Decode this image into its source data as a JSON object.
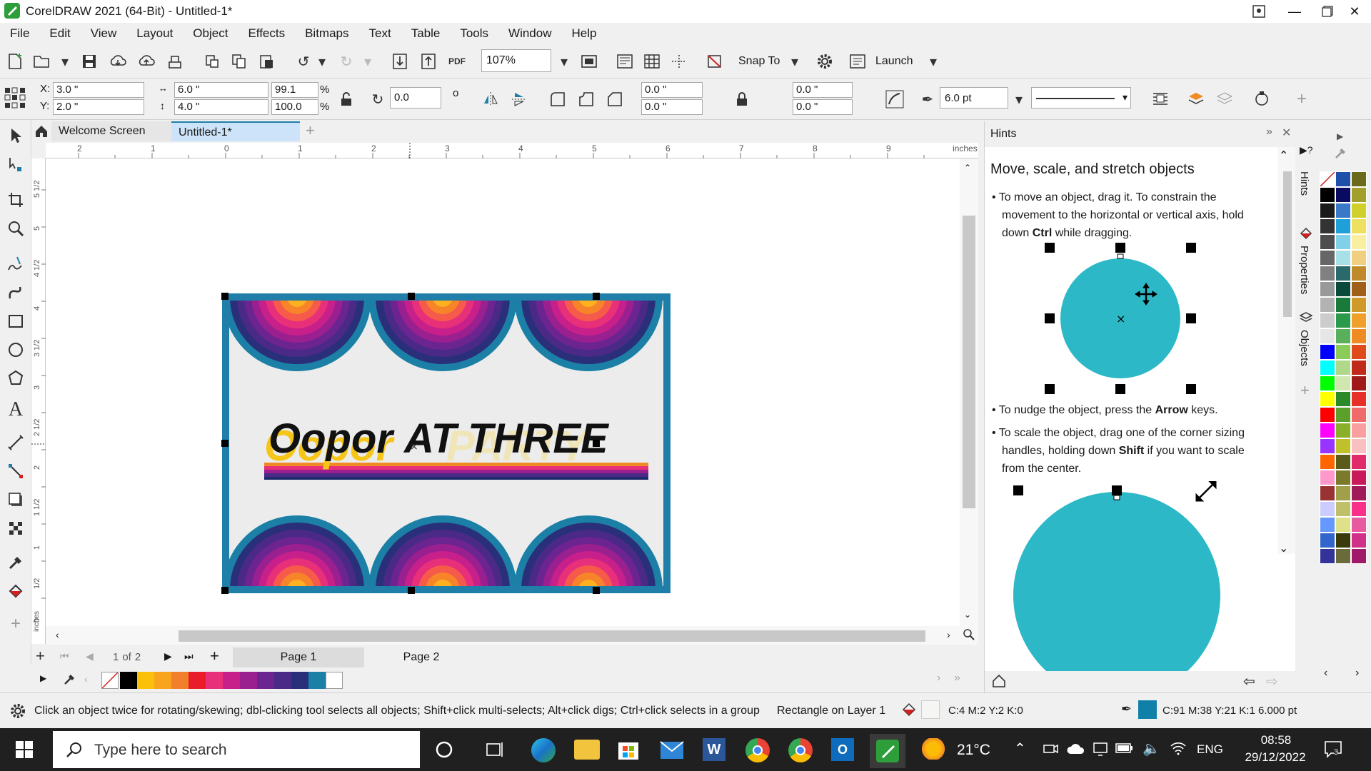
{
  "window": {
    "title": "CorelDRAW 2021 (64-Bit) - Untitled-1*"
  },
  "menu": [
    "File",
    "Edit",
    "View",
    "Layout",
    "Object",
    "Effects",
    "Bitmaps",
    "Text",
    "Table",
    "Tools",
    "Window",
    "Help"
  ],
  "toolbar": {
    "zoom": "107%",
    "snap_to": "Snap To",
    "launch": "Launch"
  },
  "properties": {
    "x_label": "X:",
    "x": "3.0 \"",
    "y_label": "Y:",
    "y": "2.0 \"",
    "width": "6.0 \"",
    "height": "4.0 \"",
    "scale_x": "99.1",
    "scale_y": "100.0",
    "percent": "%",
    "rotation": "0.0",
    "degree": "o",
    "corner_1": "0.0 \"",
    "corner_2": "0.0 \"",
    "corner_3": "0.0 \"",
    "corner_4": "0.0 \"",
    "outline_width": "6.0 pt"
  },
  "doc_tabs": [
    "Welcome Screen",
    "Untitled-1*"
  ],
  "ruler": {
    "h_ticks": [
      "2",
      "1",
      "0",
      "1",
      "2",
      "3",
      "4",
      "5",
      "6",
      "7",
      "8",
      "9"
    ],
    "unit": "inches",
    "v_ticks": [
      "5 1/2",
      "5",
      "4 1/2",
      "4",
      "3 1/2",
      "3",
      "2 1/2",
      "2",
      "1 1/2",
      "1",
      "1/2",
      "0"
    ],
    "v_unit": "inches"
  },
  "artwork": {
    "text_left": "Oopor",
    "text_right": "AT THREE",
    "shadow_text": "PARTY",
    "colors": {
      "frame": "#1f7fa8",
      "bg": "#ececec",
      "text": "#111111",
      "shadow": "#f5c518"
    }
  },
  "page_nav": {
    "current": "1",
    "of": "of",
    "total": "2",
    "pages": [
      "Page 1",
      "Page 2"
    ]
  },
  "hints": {
    "panel_title": "Hints",
    "heading": "Move, scale, and stretch objects",
    "bullet1_a": "To move an object, drag it. To constrain the movement to the horizontal or vertical axis, hold down ",
    "bullet1_bold": "Ctrl",
    "bullet1_b": " while dragging.",
    "bullet2_a": "To nudge the object, press the ",
    "bullet2_bold": "Arrow",
    "bullet2_b": " keys.",
    "bullet3_a": "To scale the object, drag one of the corner sizing handles, holding down ",
    "bullet3_bold": "Shift",
    "bullet3_b": " if you want to scale from the center.",
    "circle_color": "#2cb8c6"
  },
  "side_tabs": [
    "Hints",
    "Properties",
    "Objects"
  ],
  "status": {
    "hint": "Click an object twice for rotating/skewing; dbl-clicking tool selects all objects; Shift+click multi-selects; Alt+click digs; Ctrl+click selects in a group",
    "object": "Rectangle on Layer 1",
    "fill": "C:4 M:2 Y:2 K:0",
    "outline": "C:91 M:38 Y:21 K:1  6.000 pt"
  },
  "taskbar": {
    "search_placeholder": "Type here to search",
    "temperature": "21°C",
    "language": "ENG",
    "time": "08:58",
    "date": "29/12/2022"
  }
}
